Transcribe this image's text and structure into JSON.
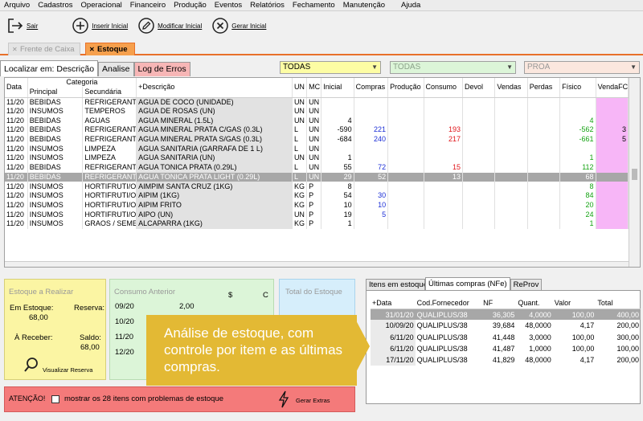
{
  "menu": [
    "Arquivo",
    "Cadastros",
    "Operacional",
    "Financeiro",
    "Produção",
    "Eventos",
    "Relatórios",
    "Fechamento",
    "Manutenção",
    "Ajuda"
  ],
  "toolbar": {
    "sair": "Sair",
    "inserir": "Inserir Inicial",
    "modificar": "Modificar Inicial",
    "gerar": "Gerar Inicial"
  },
  "form_tabs": {
    "inactive": "Frente de Caixa",
    "active": "Estoque"
  },
  "sub_tabs": {
    "localizar": "Localizar em: Descrição",
    "analise": "Analise",
    "log": "Log de Erros"
  },
  "filters": {
    "f1": {
      "value": "TODAS",
      "color": "#fdfda4"
    },
    "f2": {
      "value": "TODAS",
      "color": "#dcf5d8"
    },
    "f3": {
      "value": "PROA",
      "color": "#fbe7de"
    }
  },
  "grid": {
    "headers": {
      "data": "Data",
      "categoria": "Categoria",
      "principal": "Principal",
      "secundaria": "Secundária",
      "descricao": "+Descrição",
      "un": "UN",
      "mc": "MC",
      "inicial": "Inicial",
      "compras": "Compras",
      "producao": "Produção",
      "consumo": "Consumo",
      "devol": "Devol",
      "vendas": "Vendas",
      "perdas": "Perdas",
      "fisico": "Físico",
      "vendafc": "VendaFC"
    },
    "rows": [
      [
        "11/20",
        "BEBIDAS",
        "REFRIGERANTE",
        "AGUA DE COCO (UNIDADE)",
        "UN",
        "UN",
        "",
        "",
        "",
        "",
        "",
        "",
        "",
        "",
        ""
      ],
      [
        "11/20",
        "INSUMOS",
        "TEMPEROS",
        "AGUA DE ROSAS (UN)",
        "UN",
        "UN",
        "",
        "",
        "",
        "",
        "",
        "",
        "",
        "",
        ""
      ],
      [
        "11/20",
        "BEBIDAS",
        "AGUAS",
        "AGUA MINERAL (1.5L)",
        "UN",
        "UN",
        "4",
        "",
        "",
        "",
        "",
        "",
        "",
        "4",
        ""
      ],
      [
        "11/20",
        "BEBIDAS",
        "REFRIGERANTE",
        "AGUA MINERAL PRATA C/GAS (0.3L)",
        "L",
        "UN",
        "-590",
        "221",
        "",
        "193",
        "",
        "",
        "",
        "-562",
        "3"
      ],
      [
        "11/20",
        "BEBIDAS",
        "REFRIGERANTE",
        "AGUA MINERAL PRATA S/GAS (0.3L)",
        "L",
        "UN",
        "-684",
        "240",
        "",
        "217",
        "",
        "",
        "",
        "-661",
        "5"
      ],
      [
        "11/20",
        "INSUMOS",
        "LIMPEZA",
        "AGUA SANITARIA (GARRAFA DE 1 L)",
        "L",
        "UN",
        "",
        "",
        "",
        "",
        "",
        "",
        "",
        "",
        ""
      ],
      [
        "11/20",
        "INSUMOS",
        "LIMPEZA",
        "AGUA SANITARIA (UN)",
        "UN",
        "UN",
        "1",
        "",
        "",
        "",
        "",
        "",
        "",
        "1",
        ""
      ],
      [
        "11/20",
        "BEBIDAS",
        "REFRIGERANTE",
        "AGUA TONICA PRATA (0.29L)",
        "L",
        "UN",
        "55",
        "72",
        "",
        "15",
        "",
        "",
        "",
        "112",
        ""
      ],
      [
        "11/20",
        "BEBIDAS",
        "REFRIGERANTE",
        "AGUA TONICA PRATA LIGHT (0.29L)",
        "L",
        "UN",
        "29",
        "52",
        "",
        "13",
        "",
        "",
        "",
        "68",
        ""
      ],
      [
        "11/20",
        "INSUMOS",
        "HORTIFRUTI/OL",
        "AIMPIM SANTA CRUZ (1KG)",
        "KG",
        "P",
        "8",
        "",
        "",
        "",
        "",
        "",
        "",
        "8",
        ""
      ],
      [
        "11/20",
        "INSUMOS",
        "HORTIFRUTI/OL",
        "AIPIM (1KG)",
        "KG",
        "P",
        "54",
        "30",
        "",
        "",
        "",
        "",
        "",
        "84",
        ""
      ],
      [
        "11/20",
        "INSUMOS",
        "HORTIFRUTI/OL",
        "AIPIM FRITO",
        "KG",
        "P",
        "10",
        "10",
        "",
        "",
        "",
        "",
        "",
        "20",
        ""
      ],
      [
        "11/20",
        "INSUMOS",
        "HORTIFRUTI/OL",
        "AIPO (UN)",
        "UN",
        "P",
        "19",
        "5",
        "",
        "",
        "",
        "",
        "",
        "24",
        ""
      ],
      [
        "11/20",
        "INSUMOS",
        "GRAOS / SEMEN",
        "ALCAPARRA (1KG)",
        "KG",
        "P",
        "1",
        "",
        "",
        "",
        "",
        "",
        "",
        "1",
        ""
      ]
    ]
  },
  "estoque": {
    "title": "Estoque a Realizar",
    "em_estoque_label": "Em Estoque:",
    "em_estoque_value": "68,00",
    "reserva_label": "Reserva:",
    "a_receber_label": "À Receber:",
    "saldo_label": "Saldo:",
    "saldo_value": "68,00",
    "visualizar": "Visualizar Reserva"
  },
  "consumo": {
    "title": "Consumo Anterior",
    "col1": "$",
    "col2": "C",
    "rows": [
      [
        "09/20",
        "2,00"
      ],
      [
        "10/20",
        ""
      ],
      [
        "11/20",
        ""
      ],
      [
        "12/20",
        ""
      ]
    ]
  },
  "total": {
    "title": "Total do Estoque"
  },
  "atencao": {
    "label": "ATENÇÃO!",
    "checkbox_label": "mostrar os 28 itens com problemas de estoque",
    "gerar": "Gerar Extras"
  },
  "bottom_tabs": {
    "itens": "Itens em estoque",
    "ultimas": "Últimas compras (NFe)",
    "reprov": "ReProv"
  },
  "ultimas": {
    "headers": {
      "data": "+Data",
      "cod": "Cod.Fornecedor",
      "nf": "NF",
      "quant": "Quant.",
      "valor": "Valor",
      "total": "Total"
    },
    "rows": [
      [
        "31/01/20",
        "QUALIPLUS/38",
        "36,305",
        "4,0000",
        "100,00",
        "400,00"
      ],
      [
        "10/09/20",
        "QUALIPLUS/38",
        "39,684",
        "48,0000",
        "4,17",
        "200,00"
      ],
      [
        "6/11/20",
        "QUALIPLUS/38",
        "41,448",
        "3,0000",
        "100,00",
        "300,00"
      ],
      [
        "6/11/20",
        "QUALIPLUS/38",
        "41,487",
        "1,0000",
        "100,00",
        "100,00"
      ],
      [
        "17/11/20",
        "QUALIPLUS/38",
        "41,829",
        "48,0000",
        "4,17",
        "200,00"
      ]
    ]
  },
  "tooltip": {
    "text": "Análise de estoque, com controle por item e as últimas compras."
  }
}
